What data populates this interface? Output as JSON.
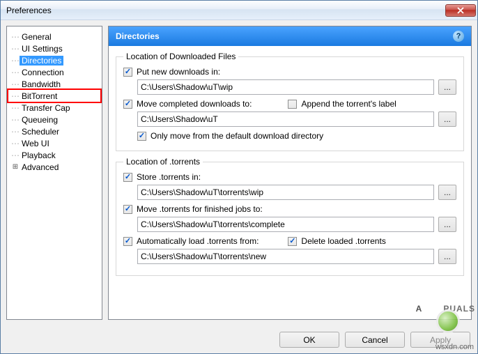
{
  "window": {
    "title": "Preferences"
  },
  "sidebar": {
    "items": [
      {
        "label": "General",
        "expandable": false
      },
      {
        "label": "UI Settings",
        "expandable": false
      },
      {
        "label": "Directories",
        "expandable": false,
        "selected": true
      },
      {
        "label": "Connection",
        "expandable": false
      },
      {
        "label": "Bandwidth",
        "expandable": false
      },
      {
        "label": "BitTorrent",
        "expandable": false,
        "highlighted": true
      },
      {
        "label": "Transfer Cap",
        "expandable": false
      },
      {
        "label": "Queueing",
        "expandable": false
      },
      {
        "label": "Scheduler",
        "expandable": false
      },
      {
        "label": "Web UI",
        "expandable": false
      },
      {
        "label": "Playback",
        "expandable": false
      },
      {
        "label": "Advanced",
        "expandable": true
      }
    ]
  },
  "header": {
    "title": "Directories",
    "help": "?"
  },
  "groups": {
    "downloaded": {
      "legend": "Location of Downloaded Files"
    },
    "torrents": {
      "legend": "Location of .torrents"
    }
  },
  "fields": {
    "put_new": {
      "label": "Put new downloads in:",
      "checked": true,
      "value": "C:\\Users\\Shadow\\uT\\wip"
    },
    "move_completed": {
      "label": "Move completed downloads to:",
      "checked": true,
      "value": "C:\\Users\\Shadow\\uT"
    },
    "append_label": {
      "label": "Append the torrent's label",
      "checked": false
    },
    "only_move": {
      "label": "Only move from the default download directory",
      "checked": true
    },
    "store_torrents": {
      "label": "Store .torrents in:",
      "checked": true,
      "value": "C:\\Users\\Shadow\\uT\\torrents\\wip"
    },
    "move_finished": {
      "label": "Move .torrents for finished jobs to:",
      "checked": true,
      "value": "C:\\Users\\Shadow\\uT\\torrents\\complete"
    },
    "auto_load": {
      "label": "Automatically load .torrents from:",
      "checked": true,
      "value": "C:\\Users\\Shadow\\uT\\torrents\\new"
    },
    "delete_loaded": {
      "label": "Delete loaded .torrents",
      "checked": true
    }
  },
  "buttons": {
    "ok": "OK",
    "cancel": "Cancel",
    "apply": "Apply",
    "browse": "..."
  },
  "watermark": {
    "site": "wsxdn.com",
    "brand_pre": "A",
    "brand_post": "PUALS"
  }
}
